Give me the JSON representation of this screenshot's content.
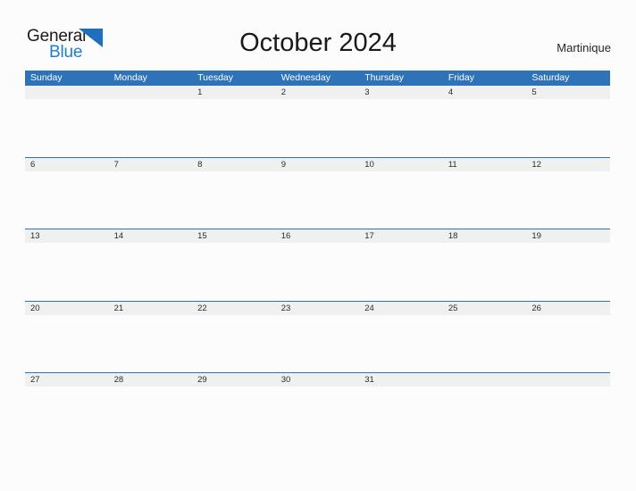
{
  "brand": {
    "name_line1": "General",
    "name_line2": "Blue",
    "mark_icon": "triangle-flag-icon",
    "accent_color": "#1f7ed0"
  },
  "header": {
    "title": "October 2024",
    "region": "Martinique"
  },
  "theme": {
    "header_blue": "#2e72b8",
    "band_gray": "#f0f0f0",
    "page_bg": "#fcfcfd",
    "text_dark": "#2b2b2b"
  },
  "calendar": {
    "month": "October",
    "year": "2024",
    "weekday_headers": [
      "Sunday",
      "Monday",
      "Tuesday",
      "Wednesday",
      "Thursday",
      "Friday",
      "Saturday"
    ],
    "weeks": [
      [
        "",
        "",
        "1",
        "2",
        "3",
        "4",
        "5"
      ],
      [
        "6",
        "7",
        "8",
        "9",
        "10",
        "11",
        "12"
      ],
      [
        "13",
        "14",
        "15",
        "16",
        "17",
        "18",
        "19"
      ],
      [
        "20",
        "21",
        "22",
        "23",
        "24",
        "25",
        "26"
      ],
      [
        "27",
        "28",
        "29",
        "30",
        "31",
        "",
        ""
      ]
    ]
  }
}
